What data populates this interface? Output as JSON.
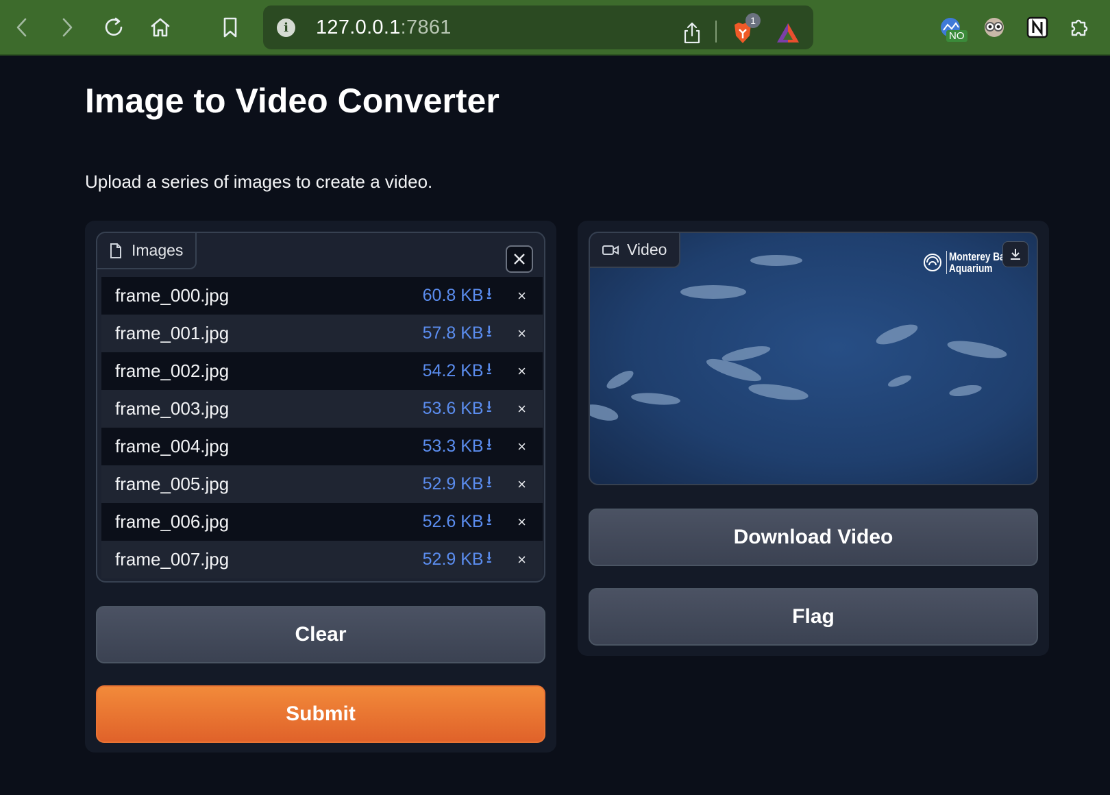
{
  "browser": {
    "url_host": "127.0.0.1",
    "url_port": ":7861",
    "brave_badge": "1",
    "ext_badge": "NO",
    "icons": [
      "back-icon",
      "forward-icon",
      "reload-icon",
      "home-icon",
      "bookmark-icon",
      "site-info-icon",
      "share-icon",
      "brave-shields-icon",
      "brave-rewards-icon",
      "extension-no-icon",
      "extension-eyes-icon",
      "notion-icon",
      "extensions-puzzle-icon"
    ]
  },
  "page": {
    "title": "Image to Video Converter",
    "description": "Upload a series of images to create a video."
  },
  "images": {
    "label": "Images",
    "files": [
      {
        "name": "frame_000.jpg",
        "size": "60.8 KB"
      },
      {
        "name": "frame_001.jpg",
        "size": "57.8 KB"
      },
      {
        "name": "frame_002.jpg",
        "size": "54.2 KB"
      },
      {
        "name": "frame_003.jpg",
        "size": "53.6 KB"
      },
      {
        "name": "frame_004.jpg",
        "size": "53.3 KB"
      },
      {
        "name": "frame_005.jpg",
        "size": "52.9 KB"
      },
      {
        "name": "frame_006.jpg",
        "size": "52.6 KB"
      },
      {
        "name": "frame_007.jpg",
        "size": "52.9 KB"
      }
    ],
    "download_glyph": "⭳",
    "remove_glyph": "×"
  },
  "buttons": {
    "clear": "Clear",
    "submit": "Submit",
    "download_video": "Download Video",
    "flag": "Flag"
  },
  "video": {
    "label": "Video",
    "watermark_line1": "Monterey Bay",
    "watermark_line2": "Aquarium"
  },
  "colors": {
    "toolbar": "#3d6b2c",
    "background": "#0b0f19",
    "panel": "#141a27",
    "accent_primary": "#ea7434",
    "file_size_link": "#5b8def"
  }
}
